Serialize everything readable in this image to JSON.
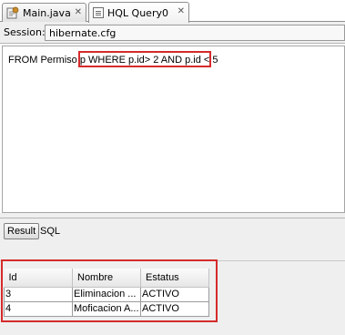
{
  "tabs": [
    {
      "label": "Main.java",
      "icon": "java-file-icon",
      "active": false,
      "close": "✕"
    },
    {
      "label": "HQL Query0",
      "icon": "hql-query-icon",
      "active": true,
      "close": "✕"
    }
  ],
  "session": {
    "label": "Session:",
    "value": "hibernate.cfg"
  },
  "editor": {
    "query_prefix": "FROM Permiso p ",
    "query_highlighted": "WHERE p.id> 2 AND p.id < 5"
  },
  "results_panel": {
    "result_tab": "Result",
    "sql_tab": "SQL"
  },
  "results_table": {
    "columns": [
      "Id",
      "Nombre",
      "Estatus"
    ],
    "rows": [
      [
        "3",
        "Eliminacion ...",
        "ACTIVO"
      ],
      [
        "4",
        "Moficacion A...",
        "ACTIVO"
      ]
    ]
  },
  "colors": {
    "highlight": "#d52b2b",
    "panel_bg": "#efefef"
  }
}
